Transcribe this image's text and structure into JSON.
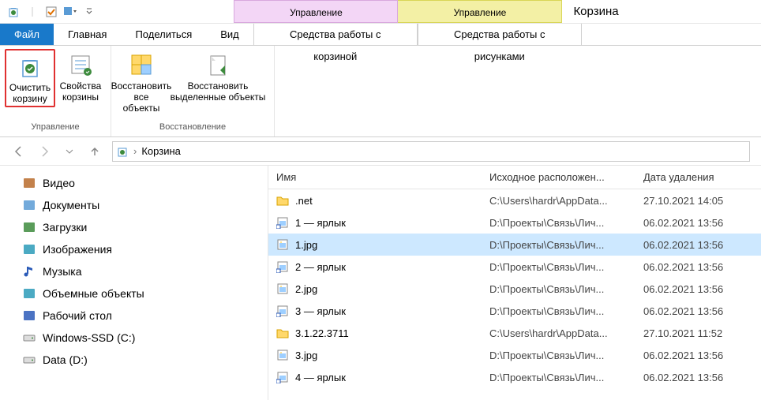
{
  "window": {
    "title": "Корзина",
    "context_headers": [
      "Управление",
      "Управление"
    ]
  },
  "tabs": {
    "file": "Файл",
    "main": [
      "Главная",
      "Поделиться",
      "Вид"
    ],
    "context": [
      "Средства работы с корзиной",
      "Средства работы с рисунками"
    ]
  },
  "ribbon": {
    "groups": [
      {
        "label": "Управление",
        "buttons": [
          {
            "line1": "Очистить",
            "line2": "корзину",
            "icon": "recycle-bin",
            "highlighted": true
          },
          {
            "line1": "Свойства",
            "line2": "корзины",
            "icon": "properties"
          }
        ]
      },
      {
        "label": "Восстановление",
        "buttons": [
          {
            "line1": "Восстановить",
            "line2": "все объекты",
            "icon": "restore-all"
          },
          {
            "line1": "Восстановить",
            "line2": "выделенные объекты",
            "icon": "restore-selected",
            "wide": true
          }
        ]
      }
    ]
  },
  "addressbar": {
    "location": "Корзина"
  },
  "nav_pane": [
    {
      "label": "Видео",
      "icon": "video"
    },
    {
      "label": "Документы",
      "icon": "documents"
    },
    {
      "label": "Загрузки",
      "icon": "downloads"
    },
    {
      "label": "Изображения",
      "icon": "pictures"
    },
    {
      "label": "Музыка",
      "icon": "music"
    },
    {
      "label": "Объемные объекты",
      "icon": "3d"
    },
    {
      "label": "Рабочий стол",
      "icon": "desktop"
    },
    {
      "label": "Windows-SSD (C:)",
      "icon": "drive"
    },
    {
      "label": "Data (D:)",
      "icon": "drive"
    }
  ],
  "columns": {
    "name": "Имя",
    "location": "Исходное расположен...",
    "date": "Дата удаления"
  },
  "files": [
    {
      "name": ".net",
      "location": "C:\\Users\\hardr\\AppData...",
      "date": "27.10.2021 14:05",
      "icon": "folder"
    },
    {
      "name": "1 — ярлык",
      "location": "D:\\Проекты\\Связь\\Лич...",
      "date": "06.02.2021 13:56",
      "icon": "shortcut"
    },
    {
      "name": "1.jpg",
      "location": "D:\\Проекты\\Связь\\Лич...",
      "date": "06.02.2021 13:56",
      "icon": "image",
      "selected": true
    },
    {
      "name": "2 — ярлык",
      "location": "D:\\Проекты\\Связь\\Лич...",
      "date": "06.02.2021 13:56",
      "icon": "shortcut"
    },
    {
      "name": "2.jpg",
      "location": "D:\\Проекты\\Связь\\Лич...",
      "date": "06.02.2021 13:56",
      "icon": "image"
    },
    {
      "name": "3 — ярлык",
      "location": "D:\\Проекты\\Связь\\Лич...",
      "date": "06.02.2021 13:56",
      "icon": "shortcut"
    },
    {
      "name": "3.1.22.3711",
      "location": "C:\\Users\\hardr\\AppData...",
      "date": "27.10.2021 11:52",
      "icon": "folder"
    },
    {
      "name": "3.jpg",
      "location": "D:\\Проекты\\Связь\\Лич...",
      "date": "06.02.2021 13:56",
      "icon": "image"
    },
    {
      "name": "4 — ярлык",
      "location": "D:\\Проекты\\Связь\\Лич...",
      "date": "06.02.2021 13:56",
      "icon": "shortcut"
    }
  ]
}
